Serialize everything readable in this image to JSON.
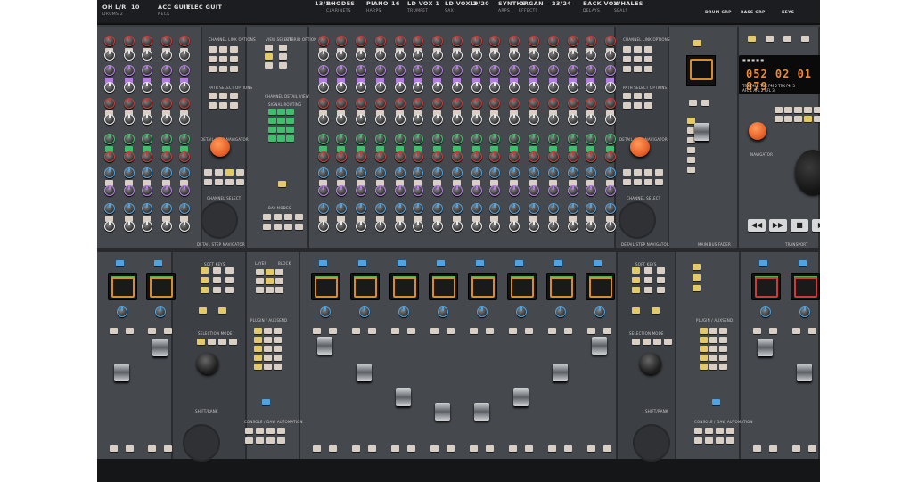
{
  "scribble_strips": [
    {
      "name": "OH L/R",
      "sub": "DRUMS 2"
    },
    {
      "name": "10",
      "sub": ""
    },
    {
      "name": "ACC GUIT",
      "sub": "NECK"
    },
    {
      "name": "ELEC GUIT",
      "sub": ""
    },
    {
      "name": "13/14",
      "sub": ""
    },
    {
      "name": "RHODES",
      "sub": "CLARINETS"
    },
    {
      "name": "PIANO",
      "sub": "HARPS"
    },
    {
      "name": "16",
      "sub": ""
    },
    {
      "name": "LD VOX 1",
      "sub": "TRUMPET"
    },
    {
      "name": "LD VOX 2",
      "sub": "SAX"
    },
    {
      "name": "19/20",
      "sub": ""
    },
    {
      "name": "SYNTHS",
      "sub": "ARPS"
    },
    {
      "name": "ORGAN",
      "sub": "EFFECTS"
    },
    {
      "name": "23/24",
      "sub": ""
    },
    {
      "name": "BACK VOX",
      "sub": "DELAYS"
    },
    {
      "name": "WHALES",
      "sub": "SEALS"
    }
  ],
  "top_strip_extra": [
    "DRUM GRP",
    "BASS GRP",
    "KEYS"
  ],
  "labels": {
    "channel_link_options": "CHANNEL LINK OPTIONS",
    "path_select_options": "PATH SELECT OPTIONS",
    "detail_step_navigator": "DETAIL STEP NAVIGATOR",
    "channel_select": "CHANNEL SELECT",
    "view_select": "VIEW SELECT",
    "hybrid_option": "HYBRID OPTION",
    "channel_detail_view": "CHANNEL DETAIL VIEW",
    "signal_routing": "SIGNAL ROUTING",
    "bay_modes": "BAY MODES",
    "soft_keys": "SOFT KEYS",
    "selection_mode": "SELECTION MODE",
    "layer": "LAYER",
    "block": "BLOCK",
    "plugin_aux_send": "PLUGIN / AUXSEND",
    "console_daw_automation": "CONSOLE / DAW AUTOMATION",
    "main_bus_fader": "MAIN BUS FADER",
    "transport": "TRANSPORT",
    "navigator": "NAVIGATOR",
    "shift_rank": "SHIFT/RANK"
  },
  "timecode": {
    "value": "052 02 01 879",
    "rows": [
      "TRK PM 1   TRK PM 2   TRK PM 3",
      "AFL 1      AFL 2      AFL 3"
    ]
  },
  "transport_buttons": [
    {
      "name": "rewind",
      "glyph": "◀◀"
    },
    {
      "name": "fast-forward",
      "glyph": "▶▶"
    },
    {
      "name": "stop",
      "glyph": "■"
    },
    {
      "name": "play",
      "glyph": "▶"
    }
  ],
  "colors": {
    "panel": "#45484d",
    "accent_orange": "#e8622a",
    "led_blue": "#4fa3e0",
    "led_yellow": "#e4c96b",
    "led_green": "#3fbf6e",
    "led_purple": "#b27ee0",
    "led_red": "#cc3a3a"
  }
}
